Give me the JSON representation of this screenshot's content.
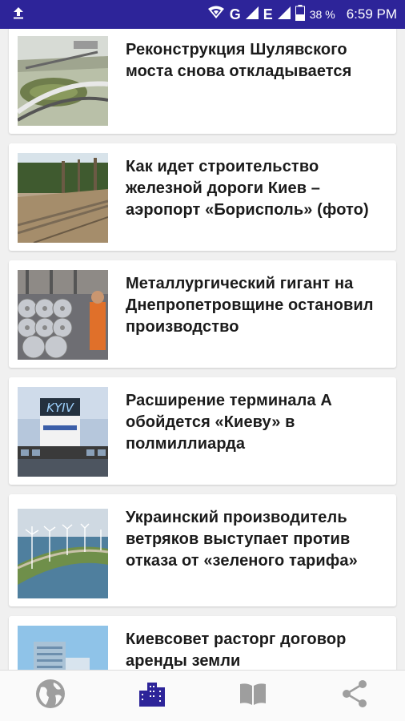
{
  "status_bar": {
    "signal_1": "G",
    "signal_2": "E",
    "battery": "38 %",
    "time": "6:59 PM",
    "icons": [
      "upload-icon",
      "wifi-hotspot-icon",
      "signal-icon",
      "battery-icon"
    ]
  },
  "articles": [
    {
      "title": "Реконструкция Шулявского моста снова откладывается",
      "image": "bridge-aerial-image"
    },
    {
      "title": "Как идет строительство железной дороги Киев – аэропорт «Борисполь» (фото)",
      "image": "railway-construction-image"
    },
    {
      "title": "Металлургический гигант на Днепропетровщине остановил производство",
      "image": "steel-coils-image"
    },
    {
      "title": "Расширение терминала А обойдется «Киеву» в полмиллиарда",
      "image": "airport-terminal-image"
    },
    {
      "title": "Украинский производитель ветряков выступает против отказа от «зеленого тарифа»",
      "image": "wind-turbines-image"
    },
    {
      "title": "Киевсовет расторг договор аренды земли",
      "image": "building-image"
    }
  ],
  "bottom_nav": {
    "items": [
      {
        "icon": "globe-icon",
        "active": false
      },
      {
        "icon": "city-icon",
        "active": true
      },
      {
        "icon": "book-icon",
        "active": false
      },
      {
        "icon": "share-icon",
        "active": false
      }
    ],
    "active_color": "#2d2499",
    "inactive_color": "#9e9e9e"
  }
}
